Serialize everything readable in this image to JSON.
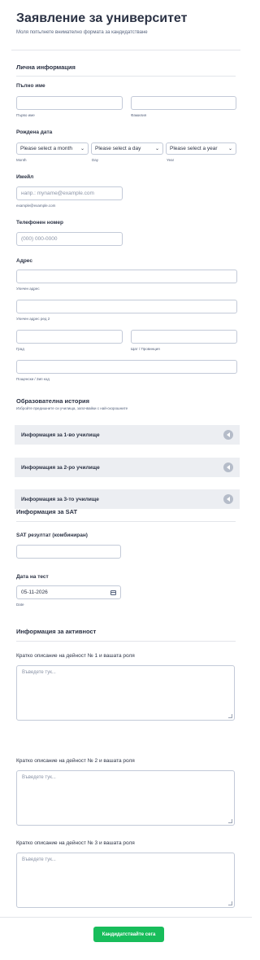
{
  "header": {
    "title": "Заявление за университет",
    "subtitle": "Моля попълнете внимателно формата за кандидатстване"
  },
  "personal": {
    "section_title": "Лична информация",
    "full_name": {
      "label": "Пълно име",
      "first_sublabel": "Първо име",
      "last_sublabel": "Фамилия"
    },
    "birth_date": {
      "label": "Рождена дата",
      "month_value": "Please select a month",
      "day_value": "Please select a day",
      "year_value": "Please select a year",
      "month_sublabel": "Month",
      "day_sublabel": "Day",
      "year_sublabel": "Year"
    },
    "email": {
      "label": "Имейл",
      "placeholder": "напр.: myname@example.com",
      "sublabel": "example@example.com"
    },
    "phone": {
      "label": "Телефонен номер",
      "placeholder": "(000) 000-0000"
    },
    "address": {
      "label": "Адрес",
      "street_sublabel": "Уличен адрес",
      "street2_sublabel": "Уличен адрес ред 2",
      "city_sublabel": "Град",
      "state_sublabel": "Щат / Провинция",
      "zip_sublabel": "Пощенски / Зип код"
    }
  },
  "education": {
    "section_title": "Образователна история",
    "section_sub": "Избройте предишните си училища, започвайки с най-скорошните",
    "schools": [
      "Информация за 1-во училище",
      "Информация за 2-ро училище",
      "Информация за 3-то училище"
    ]
  },
  "sat": {
    "section_title": "Информация за SAT",
    "score_label": "SAT резултат (комбиниран)",
    "date_label": "Дата на тест",
    "date_value": "05-11-2026",
    "date_sublabel": "Date"
  },
  "activities": {
    "section_title": "Информация за активност",
    "items": [
      {
        "label": "Кратко описание на дейност № 1 и вашата роля",
        "placeholder": "Въведете тук..."
      },
      {
        "label": "Кратко описание на дейност № 2 и вашата роля",
        "placeholder": "Въведете тук..."
      },
      {
        "label": "Кратко описание на дейност № 3 и вашата роля",
        "placeholder": "Въведете тук..."
      }
    ]
  },
  "submit": {
    "label": "Кандидатствайте сега",
    "color": "#18bd5b"
  }
}
